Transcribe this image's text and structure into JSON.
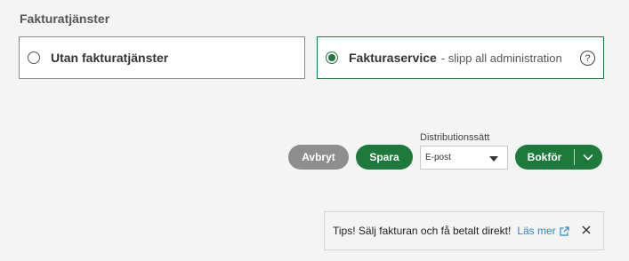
{
  "section": {
    "title": "Fakturatjänster"
  },
  "options": [
    {
      "label": "Utan fakturatjänster",
      "sublabel": "",
      "selected": false
    },
    {
      "label": "Fakturaservice",
      "sublabel": "- slipp all administration",
      "selected": true,
      "help_icon": "question-icon"
    }
  ],
  "actions": {
    "cancel_label": "Avbryt",
    "save_label": "Spara",
    "distribution_label": "Distributionssätt",
    "distribution_value": "E-post",
    "book_label": "Bokför"
  },
  "tip": {
    "text": "Tips! Sälj fakturan och få betalt direkt!",
    "link_label": "Läs mer",
    "link_icon": "external-link-icon",
    "close_icon": "close-icon"
  },
  "colors": {
    "accent": "#1e7a3a",
    "cancel": "#8e8e8e",
    "link": "#2a8bc4",
    "background": "#f4f4f4"
  }
}
